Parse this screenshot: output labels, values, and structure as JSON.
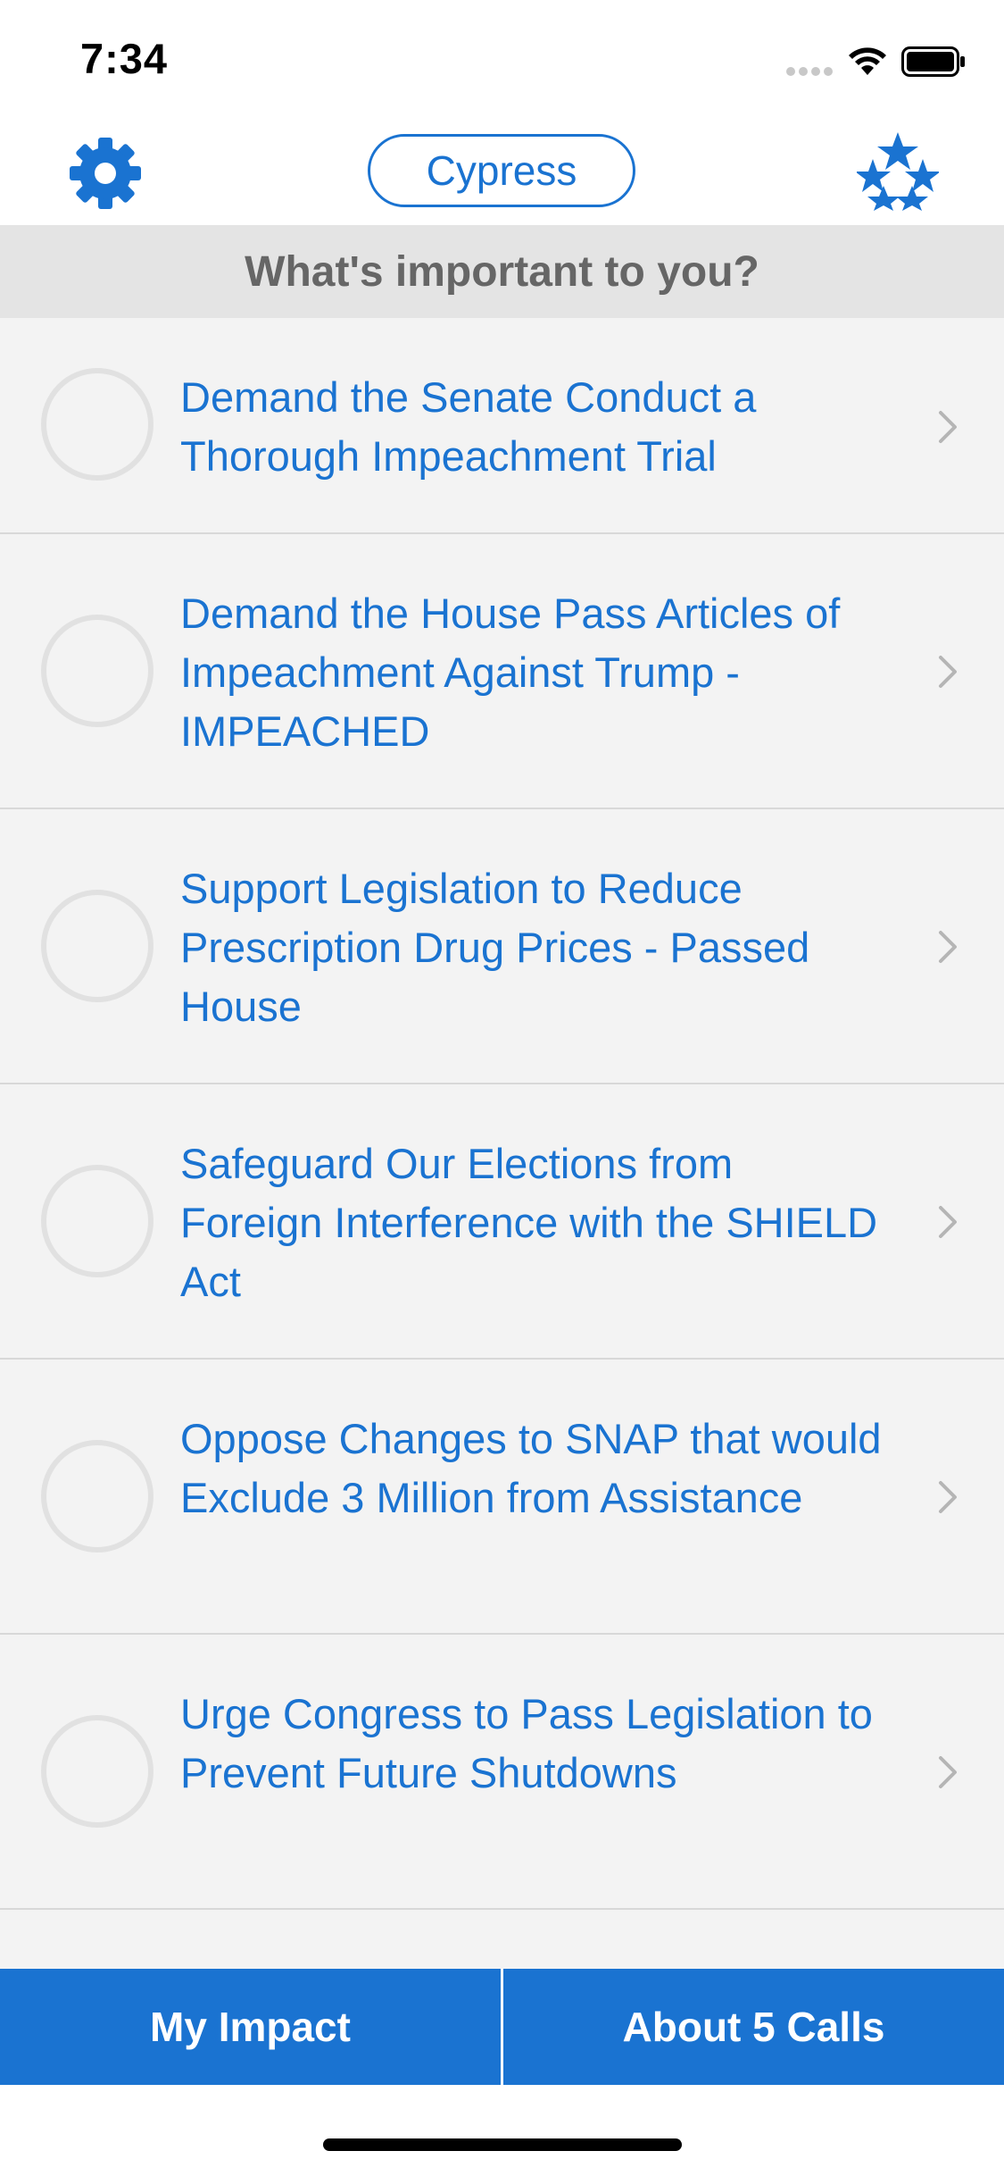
{
  "status_bar": {
    "time": "7:34"
  },
  "nav": {
    "location": "Cypress",
    "settings_icon": "gear-icon",
    "favorites_icon": "stars-icon"
  },
  "section_header": "What's important to you?",
  "issues": [
    {
      "title": "Demand the Senate Conduct a Thorough Impeachment Trial"
    },
    {
      "title": "Demand the House Pass Articles of Impeachment Against Trump - IMPEACHED"
    },
    {
      "title": "Support Legislation to Reduce Prescription Drug Prices - Passed House"
    },
    {
      "title": "Safeguard Our Elections from Foreign Interference with the SHIELD Act"
    },
    {
      "title": "Oppose Changes to SNAP that would Exclude 3 Million from Assistance"
    },
    {
      "title": "Urge Congress to Pass Legislation to Prevent Future Shutdowns"
    }
  ],
  "tabs": {
    "my_impact": "My Impact",
    "about": "About 5 Calls"
  },
  "colors": {
    "accent": "#1a73d1",
    "list_background": "#f3f3f3",
    "header_background": "#e4e4e4"
  }
}
